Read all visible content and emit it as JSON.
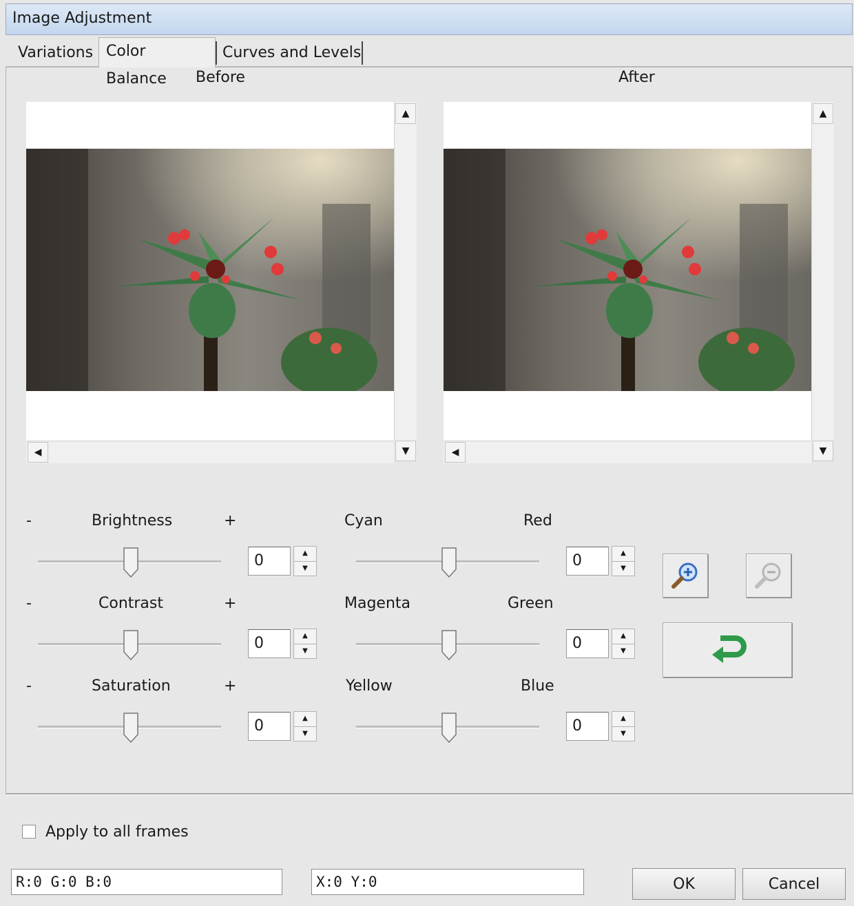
{
  "window": {
    "title": "Image Adjustment"
  },
  "tabs": [
    {
      "label": "Variations"
    },
    {
      "label": "Color Balance"
    },
    {
      "label": "Curves and Levels"
    }
  ],
  "preview": {
    "before_label": "Before",
    "after_label": "After"
  },
  "sliders_left": [
    {
      "minus": "-",
      "label": "Brightness",
      "plus": "+",
      "value": "0"
    },
    {
      "minus": "-",
      "label": "Contrast",
      "plus": "+",
      "value": "0"
    },
    {
      "minus": "-",
      "label": "Saturation",
      "plus": "+",
      "value": "0"
    }
  ],
  "sliders_right": [
    {
      "left_label": "Cyan",
      "right_label": "Red",
      "value": "0"
    },
    {
      "left_label": "Magenta",
      "right_label": "Green",
      "value": "0"
    },
    {
      "left_label": "Yellow",
      "right_label": "Blue",
      "value": "0"
    }
  ],
  "tools": {
    "zoom_in_icon": "magnifier-plus-icon",
    "zoom_out_icon": "magnifier-minus-icon",
    "reset_icon": "undo-arrow-icon"
  },
  "options": {
    "apply_all_label": "Apply to all frames",
    "apply_all_checked": false
  },
  "status": {
    "rgb": "R:0 G:0 B:0",
    "xy": "X:0 Y:0"
  },
  "buttons": {
    "ok": "OK",
    "cancel": "Cancel"
  },
  "colors": {
    "title_gradient_top": "#dde9f6",
    "title_gradient_bottom": "#c3d6ee",
    "reset_arrow": "#2e9a4a"
  }
}
